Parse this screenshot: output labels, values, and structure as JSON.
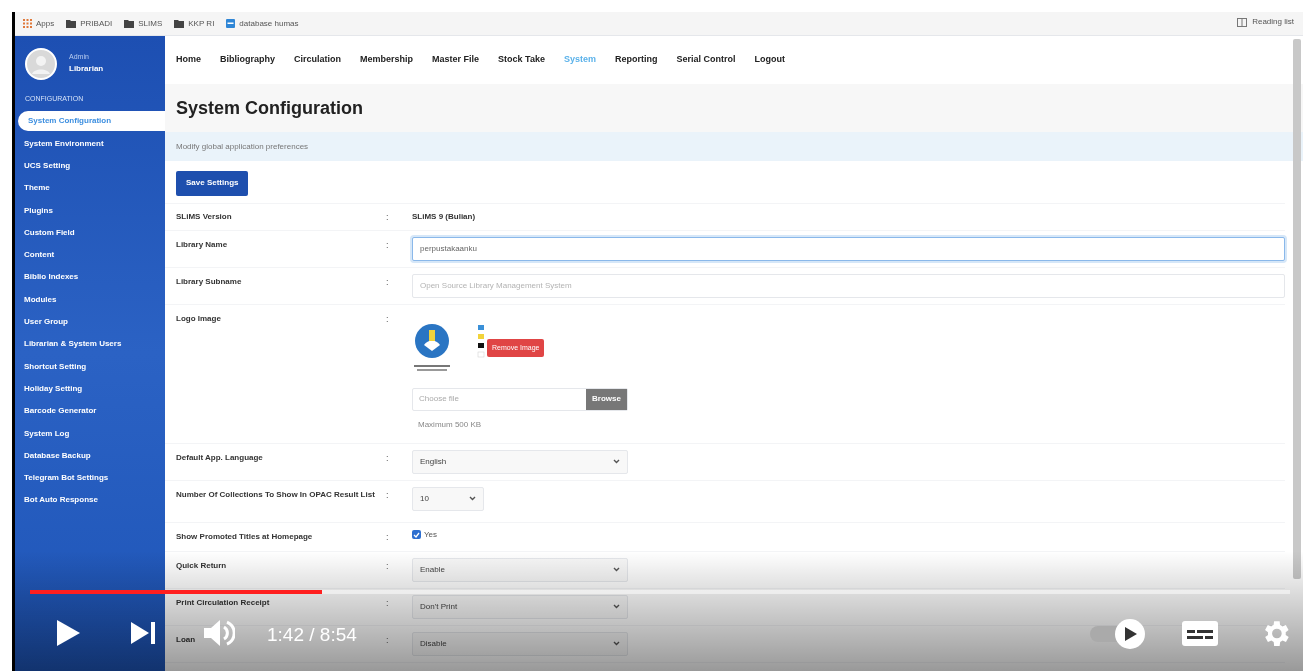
{
  "bookmarks": [
    {
      "label": "Apps",
      "kind": "apps"
    },
    {
      "label": "PRIBADI",
      "kind": "folder"
    },
    {
      "label": "SLIMS",
      "kind": "folder"
    },
    {
      "label": "KKP RI",
      "kind": "folder"
    },
    {
      "label": "database humas",
      "kind": "site"
    }
  ],
  "reading_list": "Reading list",
  "user": {
    "role": "Admin",
    "name": "Librarian"
  },
  "sidebar": {
    "heading": "CONFIGURATION",
    "items": [
      {
        "label": "System Configuration",
        "selected": true
      },
      {
        "label": "System Environment",
        "selected": false
      },
      {
        "label": "UCS Setting",
        "selected": false
      },
      {
        "label": "Theme",
        "selected": false
      },
      {
        "label": "Plugins",
        "selected": false
      },
      {
        "label": "Custom Field",
        "selected": false
      },
      {
        "label": "Content",
        "selected": false
      },
      {
        "label": "Biblio Indexes",
        "selected": false
      },
      {
        "label": "Modules",
        "selected": false
      },
      {
        "label": "User Group",
        "selected": false
      },
      {
        "label": "Librarian & System Users",
        "selected": false
      },
      {
        "label": "Shortcut Setting",
        "selected": false
      },
      {
        "label": "Holiday Setting",
        "selected": false
      },
      {
        "label": "Barcode Generator",
        "selected": false
      },
      {
        "label": "System Log",
        "selected": false
      },
      {
        "label": "Database Backup",
        "selected": false
      },
      {
        "label": "Telegram Bot Settings",
        "selected": false
      },
      {
        "label": "Bot Auto Response",
        "selected": false
      }
    ]
  },
  "nav": [
    {
      "label": "Home",
      "selected": false
    },
    {
      "label": "Bibliography",
      "selected": false
    },
    {
      "label": "Circulation",
      "selected": false
    },
    {
      "label": "Membership",
      "selected": false
    },
    {
      "label": "Master File",
      "selected": false
    },
    {
      "label": "Stock Take",
      "selected": false
    },
    {
      "label": "System",
      "selected": true
    },
    {
      "label": "Reporting",
      "selected": false
    },
    {
      "label": "Serial Control",
      "selected": false
    },
    {
      "label": "Logout",
      "selected": false
    }
  ],
  "page": {
    "title": "System Configuration",
    "subtitle": "Modify global application preferences",
    "save_button": "Save Settings"
  },
  "separator": ":",
  "settings": [
    {
      "label": "SLiMS Version",
      "kind": "static",
      "value": "SLiMS 9 (Bulian)"
    },
    {
      "label": "Library Name",
      "kind": "text",
      "value": "perpustakaanku",
      "focused": true
    },
    {
      "label": "Library Subname",
      "kind": "text",
      "placeholder": "Open Source Library Management System",
      "focused": false
    },
    {
      "label": "Logo Image",
      "kind": "logo",
      "remove_button": "Remove Image",
      "file_placeholder": "Choose file",
      "browse_button": "Browse",
      "note": "Maximum 500 KB"
    },
    {
      "label": "Default App. Language",
      "kind": "select",
      "value": "English"
    },
    {
      "label": "Number Of Collections To Show In OPAC Result List",
      "kind": "short_select",
      "value": "10"
    },
    {
      "label": "Show Promoted Titles at Homepage",
      "kind": "checkbox",
      "checked": true,
      "option": "Yes"
    },
    {
      "label": "Quick Return",
      "kind": "select",
      "value": "Enable"
    },
    {
      "label": "Print Circulation Receipt",
      "kind": "select",
      "value": "Don't Print"
    },
    {
      "label": "Loan",
      "kind": "select",
      "value": "Disable"
    }
  ],
  "player": {
    "time": "1:42 / 8:54",
    "progress": {
      "level": 0.232
    }
  }
}
